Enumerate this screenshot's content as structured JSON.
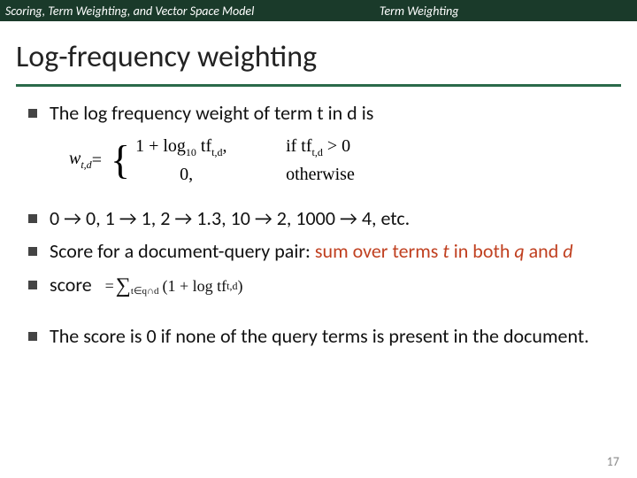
{
  "header": {
    "left": "Scoring, Term Weighting, and Vector Space Model",
    "right": "Term Weighting"
  },
  "title": "Log-frequency weighting",
  "bullets": {
    "b1": "The log frequency weight of term t in d is",
    "b2": "0 → 0, 1 → 1, 2 → 1.3, 10 → 2, 1000 → 4, etc.",
    "b3_pre": "Score for a document-query pair: ",
    "b3_hl": "sum over terms ",
    "b3_t": "t",
    "b3_mid": " in both ",
    "b3_q": "q",
    "b3_and": " and ",
    "b3_d": "d",
    "b4": "score",
    "b5": "The score is 0 if none of the query terms is present in the document."
  },
  "formula": {
    "lhs": "w",
    "lhs_sub": "t,d",
    "eq": " = ",
    "case1_val_a": "1 + log",
    "case1_val_b": "10",
    "case1_val_c": " tf",
    "case1_val_d": "t,d",
    "case1_val_e": ",",
    "case1_cond_a": "if tf",
    "case1_cond_b": "t,d",
    "case1_cond_c": " > 0",
    "case2_val": "0,",
    "case2_cond": "otherwise"
  },
  "score_formula": {
    "eq": "= ",
    "sigma": "∑",
    "sub": "t∈q∩d",
    "body_a": "(1 + log tf",
    "body_b": "t,d",
    "body_c": ")"
  },
  "page_number": "17"
}
